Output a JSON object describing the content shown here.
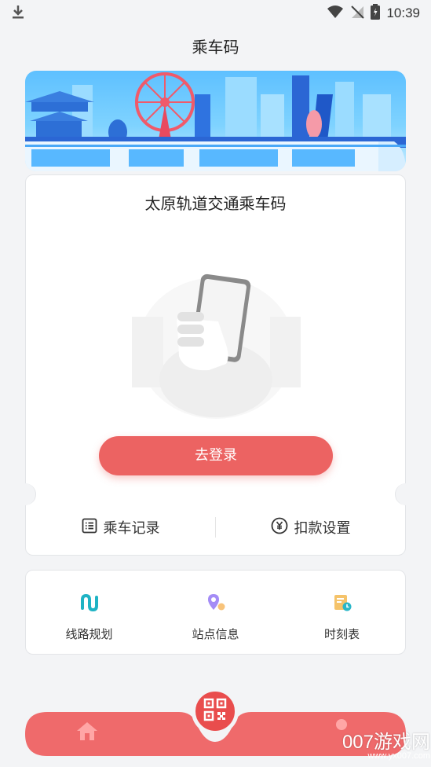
{
  "status_bar": {
    "time": "10:39"
  },
  "page": {
    "title": "乘车码"
  },
  "ticket": {
    "title": "太原轨道交通乘车码",
    "login_label": "去登录",
    "actions": [
      {
        "label": "乘车记录",
        "icon": "list-icon"
      },
      {
        "label": "扣款设置",
        "icon": "yen-icon"
      }
    ]
  },
  "services": [
    {
      "label": "线路规划",
      "icon": "route-icon"
    },
    {
      "label": "站点信息",
      "icon": "location-pin-icon"
    },
    {
      "label": "时刻表",
      "icon": "timetable-icon"
    }
  ],
  "bottom_nav": {
    "items": [
      {
        "icon": "home-icon"
      },
      {
        "icon": "qr-code-icon"
      },
      {
        "icon": "user-icon"
      }
    ]
  },
  "watermark": {
    "text": "007游戏网",
    "url": "www.yx007.com"
  },
  "colors": {
    "accent": "#ec6362",
    "nav": "#ef6a6b",
    "background": "#f3f4f6"
  }
}
